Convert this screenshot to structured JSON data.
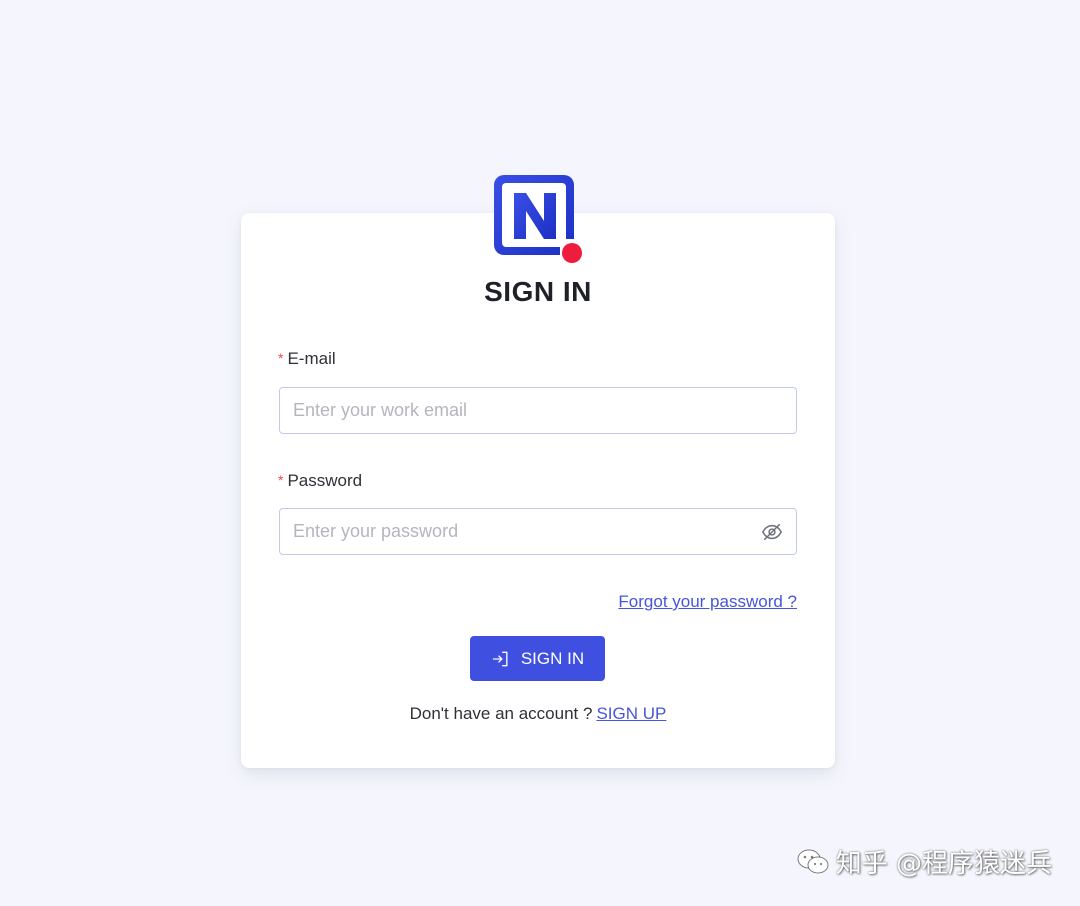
{
  "page": {
    "title": "SIGN IN",
    "logo_letter": "N",
    "colors": {
      "background": "#f5f6fd",
      "card": "#ffffff",
      "accent": "#3f4fe0",
      "link": "#4656d8",
      "required": "#f5484a",
      "logo_dot": "#ee1c3e"
    }
  },
  "form": {
    "email": {
      "required_mark": "*",
      "label": "E-mail",
      "value": "",
      "placeholder": "Enter your work email"
    },
    "password": {
      "required_mark": "*",
      "label": "Password",
      "value": "",
      "placeholder": "Enter your password",
      "toggle_icon": "eye-off-icon"
    },
    "forgot_link": "Forgot your password ?",
    "submit": {
      "label": "SIGN IN",
      "icon": "login-icon"
    },
    "signup": {
      "prompt": "Don't have an account ?",
      "link": "SIGN UP"
    }
  },
  "watermark": {
    "text": "知乎 @程序猿迷兵",
    "icon": "wechat-icon"
  }
}
